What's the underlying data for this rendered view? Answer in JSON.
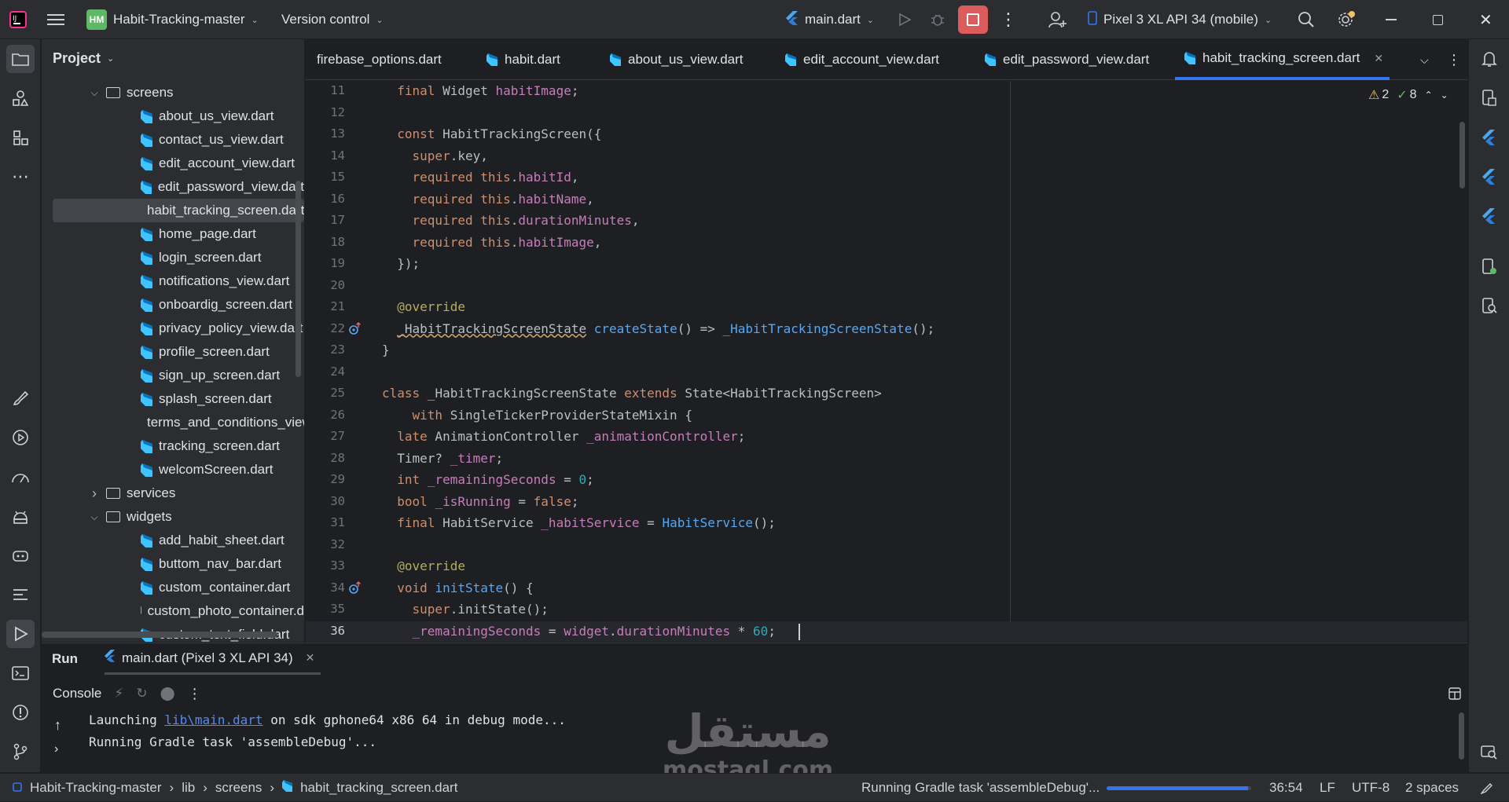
{
  "titlebar": {
    "project_badge": "HM",
    "project_name": "Habit-Tracking-master",
    "vcs": "Version control",
    "run_config": "main.dart",
    "device": "Pixel 3 XL API 34 (mobile)"
  },
  "project_panel": {
    "title": "Project",
    "tree": [
      {
        "label": "screens",
        "type": "folder",
        "expanded": true,
        "depth": 1
      },
      {
        "label": "about_us_view.dart",
        "type": "file",
        "depth": 2
      },
      {
        "label": "contact_us_view.dart",
        "type": "file",
        "depth": 2
      },
      {
        "label": "edit_account_view.dart",
        "type": "file",
        "depth": 2
      },
      {
        "label": "edit_password_view.dart",
        "type": "file",
        "depth": 2
      },
      {
        "label": "habit_tracking_screen.dart",
        "type": "file",
        "depth": 2,
        "selected": true
      },
      {
        "label": "home_page.dart",
        "type": "file",
        "depth": 2
      },
      {
        "label": "login_screen.dart",
        "type": "file",
        "depth": 2
      },
      {
        "label": "notifications_view.dart",
        "type": "file",
        "depth": 2
      },
      {
        "label": "onboardig_screen.dart",
        "type": "file",
        "depth": 2
      },
      {
        "label": "privacy_policy_view.dart",
        "type": "file",
        "depth": 2
      },
      {
        "label": "profile_screen.dart",
        "type": "file",
        "depth": 2
      },
      {
        "label": "sign_up_screen.dart",
        "type": "file",
        "depth": 2
      },
      {
        "label": "splash_screen.dart",
        "type": "file",
        "depth": 2
      },
      {
        "label": "terms_and_conditions_view",
        "type": "file",
        "depth": 2
      },
      {
        "label": "tracking_screen.dart",
        "type": "file",
        "depth": 2
      },
      {
        "label": "welcomScreen.dart",
        "type": "file",
        "depth": 2
      },
      {
        "label": "services",
        "type": "folder",
        "expanded": false,
        "depth": 1
      },
      {
        "label": "widgets",
        "type": "folder",
        "expanded": true,
        "depth": 1
      },
      {
        "label": "add_habit_sheet.dart",
        "type": "file",
        "depth": 2
      },
      {
        "label": "buttom_nav_bar.dart",
        "type": "file",
        "depth": 2
      },
      {
        "label": "custom_container.dart",
        "type": "file",
        "depth": 2
      },
      {
        "label": "custom_photo_container.d",
        "type": "file",
        "depth": 2
      },
      {
        "label": "custom_text_field.dart",
        "type": "file",
        "depth": 2
      }
    ]
  },
  "tabs": [
    {
      "label": "firebase_options.dart",
      "dart": false
    },
    {
      "label": "habit.dart",
      "dart": true
    },
    {
      "label": "about_us_view.dart",
      "dart": true
    },
    {
      "label": "edit_account_view.dart",
      "dart": true
    },
    {
      "label": "edit_password_view.dart",
      "dart": true
    },
    {
      "label": "habit_tracking_screen.dart",
      "dart": true,
      "active": true
    }
  ],
  "inspections": {
    "warnings": "2",
    "ok": "8"
  },
  "code_lines": [
    {
      "n": "11",
      "html": "  <span class='kw'>final</span> Widget <span class='fld'>habitImage</span>;"
    },
    {
      "n": "12",
      "html": ""
    },
    {
      "n": "13",
      "html": "  <span class='kw'>const</span> HabitTrackingScreen({"
    },
    {
      "n": "14",
      "html": "    <span class='kw'>super</span>.key,"
    },
    {
      "n": "15",
      "html": "    <span class='kw'>required this</span>.<span class='fld'>habitId</span>,"
    },
    {
      "n": "16",
      "html": "    <span class='kw'>required this</span>.<span class='fld'>habitName</span>,"
    },
    {
      "n": "17",
      "html": "    <span class='kw'>required this</span>.<span class='fld'>durationMinutes</span>,"
    },
    {
      "n": "18",
      "html": "    <span class='kw'>required this</span>.<span class='fld'>habitImage</span>,"
    },
    {
      "n": "19",
      "html": "  });"
    },
    {
      "n": "20",
      "html": ""
    },
    {
      "n": "21",
      "html": "  <span class='ann'>@override</span>"
    },
    {
      "n": "22",
      "html": "  <span style='text-decoration:underline wavy #c9a26d'>_HabitTrackingScreenState</span> <span class='fn'>createState</span>() => <span class='fn'>_HabitTrackingScreenState</span>();"
    },
    {
      "n": "23",
      "html": "}"
    },
    {
      "n": "24",
      "html": ""
    },
    {
      "n": "25",
      "html": "<span class='kw'>class</span> _HabitTrackingScreenState <span class='kw'>extends</span> State&lt;HabitTrackingScreen&gt;"
    },
    {
      "n": "26",
      "html": "    <span class='kw'>with</span> SingleTickerProviderStateMixin {"
    },
    {
      "n": "27",
      "html": "  <span class='kw'>late</span> AnimationController <span class='fld'>_animationController</span>;"
    },
    {
      "n": "28",
      "html": "  Timer? <span class='fld'>_timer</span>;"
    },
    {
      "n": "29",
      "html": "  <span class='kw'>int</span> <span class='fld'>_remainingSeconds</span> = <span class='num'>0</span>;"
    },
    {
      "n": "30",
      "html": "  <span class='kw'>bool</span> <span class='fld'>_isRunning</span> = <span class='kw'>false</span>;"
    },
    {
      "n": "31",
      "html": "  <span class='kw'>final</span> HabitService <span class='fld'>_habitService</span> = <span class='fn'>HabitService</span>();"
    },
    {
      "n": "32",
      "html": ""
    },
    {
      "n": "33",
      "html": "  <span class='ann'>@override</span>"
    },
    {
      "n": "34",
      "html": "  <span class='kw'>void</span> <span class='fn'>initState</span>() {"
    },
    {
      "n": "35",
      "html": "    <span class='kw'>super</span>.initState();"
    },
    {
      "n": "36",
      "html": "    <span class='fld'>_remainingSeconds</span> = <span class='fld'>widget</span>.<span class='fld'>durationMinutes</span> * <span class='num'>60</span>;"
    }
  ],
  "run_panel": {
    "title": "Run",
    "session": "main.dart (Pixel 3 XL API 34)",
    "console_tab": "Console",
    "console_lines": [
      {
        "prefix": "Launching ",
        "link": "lib\\main.dart",
        "suffix": " on sdk gphone64 x86 64 in debug mode..."
      },
      {
        "prefix": "Running Gradle task 'assembleDebug'...",
        "link": "",
        "suffix": ""
      }
    ]
  },
  "watermark": {
    "arabic": "مستقل",
    "latin": "mostaql.com"
  },
  "statusbar": {
    "breadcrumb": [
      "Habit-Tracking-master",
      "lib",
      "screens",
      "habit_tracking_screen.dart"
    ],
    "task": "Running Gradle task 'assembleDebug'...",
    "task_progress": 0.98,
    "position": "36:54",
    "line_sep": "LF",
    "encoding": "UTF-8",
    "indent": "2 spaces"
  },
  "colors": {
    "accent": "#3574f0",
    "stop": "#db5c5c",
    "badge": "#5fb865"
  }
}
